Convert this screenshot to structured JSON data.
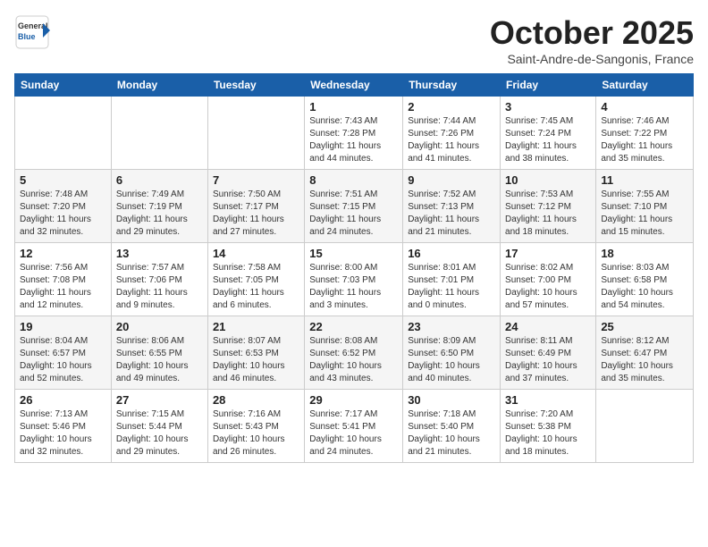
{
  "header": {
    "logo_general": "General",
    "logo_blue": "Blue",
    "month": "October 2025",
    "location": "Saint-Andre-de-Sangonis, France"
  },
  "days_of_week": [
    "Sunday",
    "Monday",
    "Tuesday",
    "Wednesday",
    "Thursday",
    "Friday",
    "Saturday"
  ],
  "weeks": [
    [
      {
        "day": "",
        "info": ""
      },
      {
        "day": "",
        "info": ""
      },
      {
        "day": "",
        "info": ""
      },
      {
        "day": "1",
        "info": "Sunrise: 7:43 AM\nSunset: 7:28 PM\nDaylight: 11 hours and 44 minutes."
      },
      {
        "day": "2",
        "info": "Sunrise: 7:44 AM\nSunset: 7:26 PM\nDaylight: 11 hours and 41 minutes."
      },
      {
        "day": "3",
        "info": "Sunrise: 7:45 AM\nSunset: 7:24 PM\nDaylight: 11 hours and 38 minutes."
      },
      {
        "day": "4",
        "info": "Sunrise: 7:46 AM\nSunset: 7:22 PM\nDaylight: 11 hours and 35 minutes."
      }
    ],
    [
      {
        "day": "5",
        "info": "Sunrise: 7:48 AM\nSunset: 7:20 PM\nDaylight: 11 hours and 32 minutes."
      },
      {
        "day": "6",
        "info": "Sunrise: 7:49 AM\nSunset: 7:19 PM\nDaylight: 11 hours and 29 minutes."
      },
      {
        "day": "7",
        "info": "Sunrise: 7:50 AM\nSunset: 7:17 PM\nDaylight: 11 hours and 27 minutes."
      },
      {
        "day": "8",
        "info": "Sunrise: 7:51 AM\nSunset: 7:15 PM\nDaylight: 11 hours and 24 minutes."
      },
      {
        "day": "9",
        "info": "Sunrise: 7:52 AM\nSunset: 7:13 PM\nDaylight: 11 hours and 21 minutes."
      },
      {
        "day": "10",
        "info": "Sunrise: 7:53 AM\nSunset: 7:12 PM\nDaylight: 11 hours and 18 minutes."
      },
      {
        "day": "11",
        "info": "Sunrise: 7:55 AM\nSunset: 7:10 PM\nDaylight: 11 hours and 15 minutes."
      }
    ],
    [
      {
        "day": "12",
        "info": "Sunrise: 7:56 AM\nSunset: 7:08 PM\nDaylight: 11 hours and 12 minutes."
      },
      {
        "day": "13",
        "info": "Sunrise: 7:57 AM\nSunset: 7:06 PM\nDaylight: 11 hours and 9 minutes."
      },
      {
        "day": "14",
        "info": "Sunrise: 7:58 AM\nSunset: 7:05 PM\nDaylight: 11 hours and 6 minutes."
      },
      {
        "day": "15",
        "info": "Sunrise: 8:00 AM\nSunset: 7:03 PM\nDaylight: 11 hours and 3 minutes."
      },
      {
        "day": "16",
        "info": "Sunrise: 8:01 AM\nSunset: 7:01 PM\nDaylight: 11 hours and 0 minutes."
      },
      {
        "day": "17",
        "info": "Sunrise: 8:02 AM\nSunset: 7:00 PM\nDaylight: 10 hours and 57 minutes."
      },
      {
        "day": "18",
        "info": "Sunrise: 8:03 AM\nSunset: 6:58 PM\nDaylight: 10 hours and 54 minutes."
      }
    ],
    [
      {
        "day": "19",
        "info": "Sunrise: 8:04 AM\nSunset: 6:57 PM\nDaylight: 10 hours and 52 minutes."
      },
      {
        "day": "20",
        "info": "Sunrise: 8:06 AM\nSunset: 6:55 PM\nDaylight: 10 hours and 49 minutes."
      },
      {
        "day": "21",
        "info": "Sunrise: 8:07 AM\nSunset: 6:53 PM\nDaylight: 10 hours and 46 minutes."
      },
      {
        "day": "22",
        "info": "Sunrise: 8:08 AM\nSunset: 6:52 PM\nDaylight: 10 hours and 43 minutes."
      },
      {
        "day": "23",
        "info": "Sunrise: 8:09 AM\nSunset: 6:50 PM\nDaylight: 10 hours and 40 minutes."
      },
      {
        "day": "24",
        "info": "Sunrise: 8:11 AM\nSunset: 6:49 PM\nDaylight: 10 hours and 37 minutes."
      },
      {
        "day": "25",
        "info": "Sunrise: 8:12 AM\nSunset: 6:47 PM\nDaylight: 10 hours and 35 minutes."
      }
    ],
    [
      {
        "day": "26",
        "info": "Sunrise: 7:13 AM\nSunset: 5:46 PM\nDaylight: 10 hours and 32 minutes."
      },
      {
        "day": "27",
        "info": "Sunrise: 7:15 AM\nSunset: 5:44 PM\nDaylight: 10 hours and 29 minutes."
      },
      {
        "day": "28",
        "info": "Sunrise: 7:16 AM\nSunset: 5:43 PM\nDaylight: 10 hours and 26 minutes."
      },
      {
        "day": "29",
        "info": "Sunrise: 7:17 AM\nSunset: 5:41 PM\nDaylight: 10 hours and 24 minutes."
      },
      {
        "day": "30",
        "info": "Sunrise: 7:18 AM\nSunset: 5:40 PM\nDaylight: 10 hours and 21 minutes."
      },
      {
        "day": "31",
        "info": "Sunrise: 7:20 AM\nSunset: 5:38 PM\nDaylight: 10 hours and 18 minutes."
      },
      {
        "day": "",
        "info": ""
      }
    ]
  ]
}
